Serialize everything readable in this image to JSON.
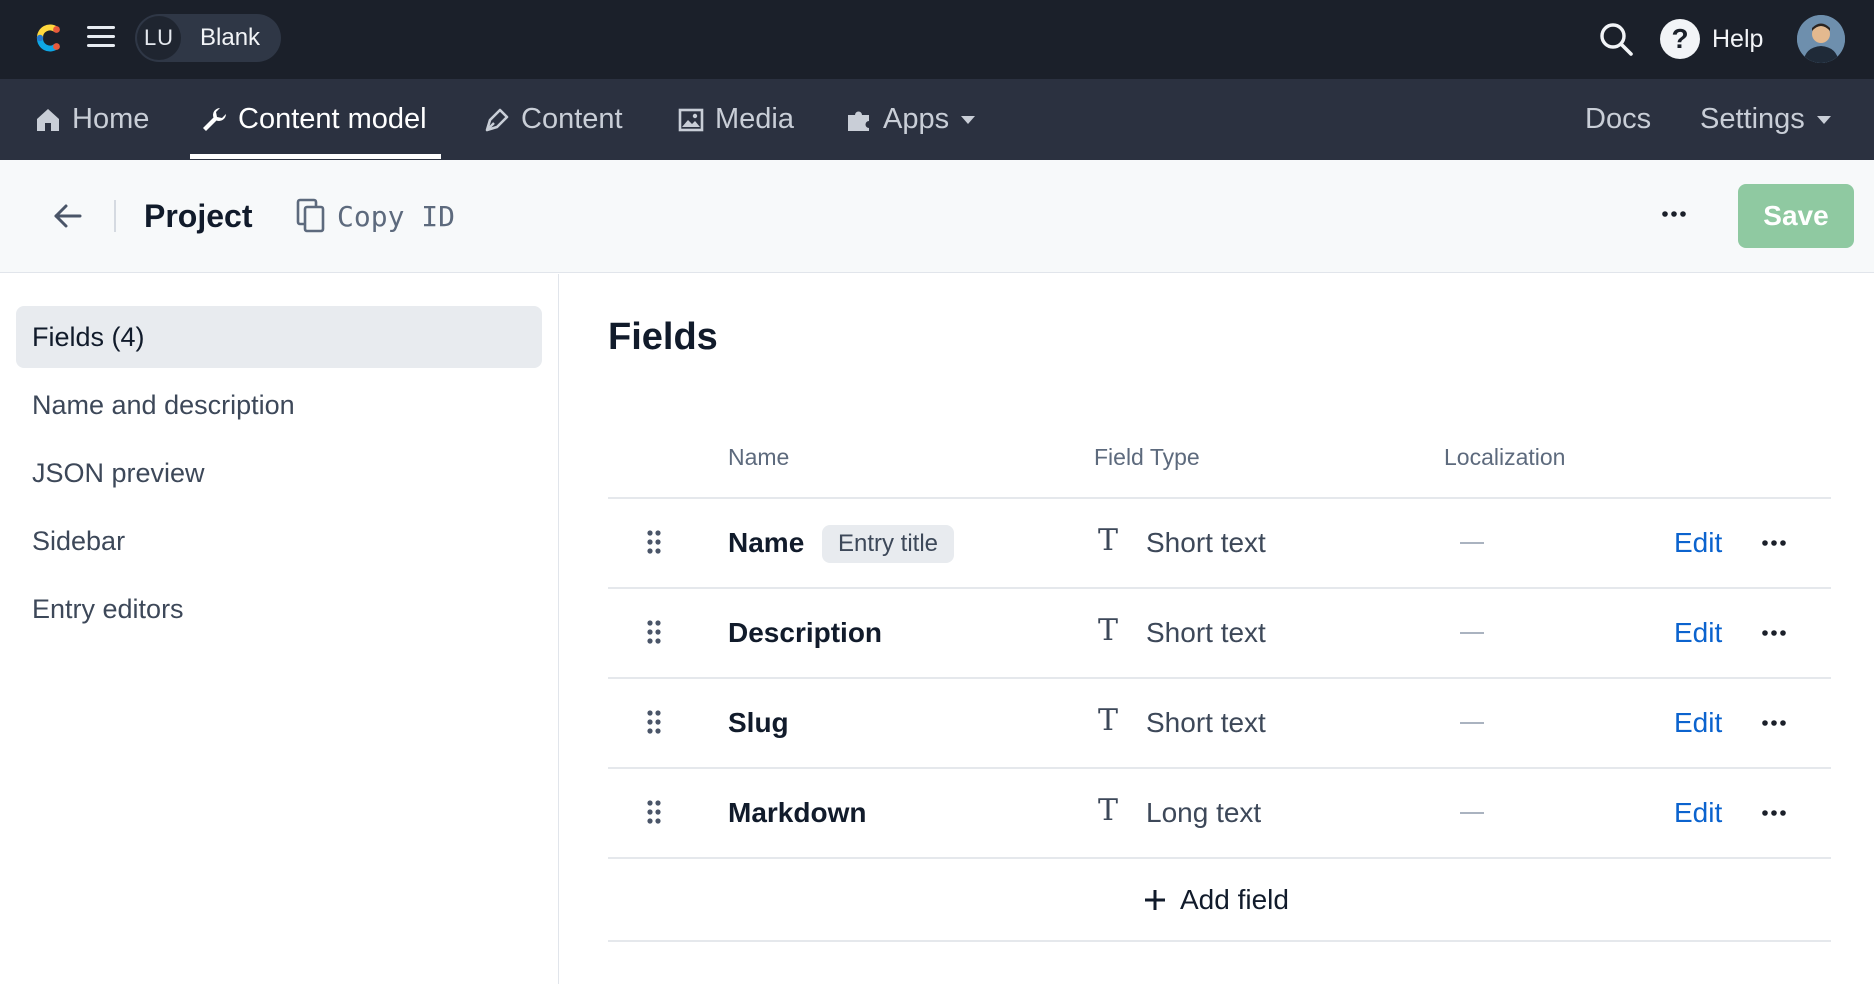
{
  "topbar": {
    "space_initials": "LU",
    "space_name": "Blank",
    "help_label": "Help",
    "icons": [
      "contentful-logo",
      "hamburger-menu-icon",
      "search-icon",
      "help-icon",
      "user-avatar"
    ]
  },
  "nav": {
    "items": [
      {
        "label": "Home",
        "icon": "home-icon"
      },
      {
        "label": "Content model",
        "icon": "wrench-icon",
        "active": true
      },
      {
        "label": "Content",
        "icon": "pen-icon"
      },
      {
        "label": "Media",
        "icon": "image-icon"
      },
      {
        "label": "Apps",
        "icon": "puzzle-icon",
        "dropdown": true
      }
    ],
    "right": [
      {
        "label": "Docs"
      },
      {
        "label": "Settings",
        "dropdown": true
      }
    ]
  },
  "header": {
    "title": "Project",
    "copy_id_label": "Copy ID",
    "save_label": "Save"
  },
  "sidebar": {
    "items": [
      {
        "label": "Fields (4)",
        "active": true
      },
      {
        "label": "Name and description"
      },
      {
        "label": "JSON preview"
      },
      {
        "label": "Sidebar"
      },
      {
        "label": "Entry editors"
      }
    ]
  },
  "main": {
    "title": "Fields",
    "columns": [
      "Name",
      "Field Type",
      "Localization"
    ],
    "rows": [
      {
        "name": "Name",
        "badge": "Entry title",
        "type": "Short text",
        "edit": "Edit"
      },
      {
        "name": "Description",
        "badge": "",
        "type": "Short text",
        "edit": "Edit"
      },
      {
        "name": "Slug",
        "badge": "",
        "type": "Short text",
        "edit": "Edit"
      },
      {
        "name": "Markdown",
        "badge": "",
        "type": "Long text",
        "edit": "Edit"
      }
    ],
    "add_field_label": "Add field",
    "type_icon_glyph": "T"
  },
  "colors": {
    "topbar_bg": "#1b202a",
    "navbar_bg": "#2b3140",
    "save_bg": "#8fc9a1",
    "link": "#0b63ce"
  }
}
